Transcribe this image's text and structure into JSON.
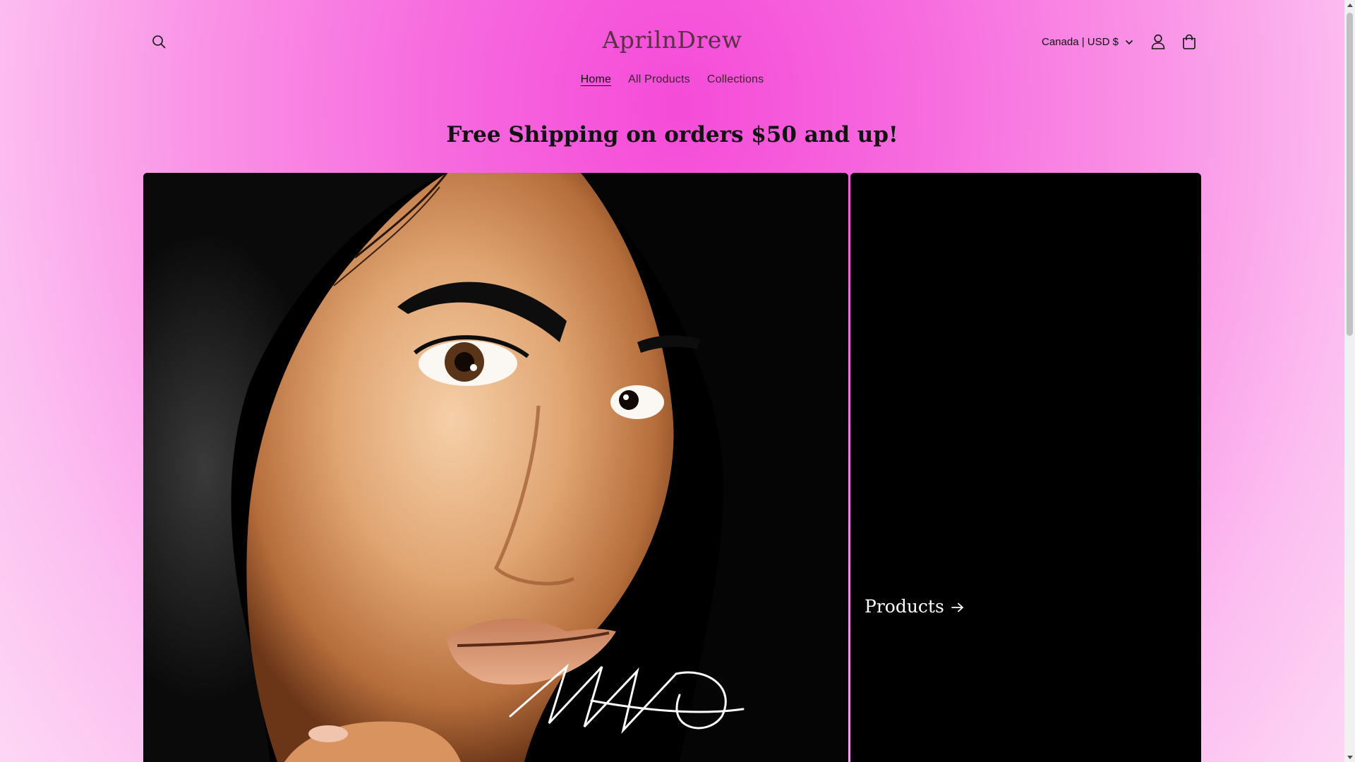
{
  "header": {
    "logo": "AprilnDrew",
    "nav": [
      {
        "label": "Home",
        "active": true
      },
      {
        "label": "All Products",
        "active": false
      },
      {
        "label": "Collections",
        "active": false
      }
    ],
    "locale": "Canada | USD $",
    "icons": {
      "search": "search-icon",
      "account": "account-icon",
      "cart": "cart-icon",
      "dropdown": "chevron-down-icon"
    }
  },
  "announcement": "Free Shipping on orders $50 and up!",
  "hero": {
    "image": "illustrated portrait of a woman with a signature",
    "collection_link": "Products",
    "link_icon": "arrow-right-icon"
  },
  "colors": {
    "background_accent": "#f54bd8",
    "panel": "#000000",
    "text": "#121212"
  }
}
